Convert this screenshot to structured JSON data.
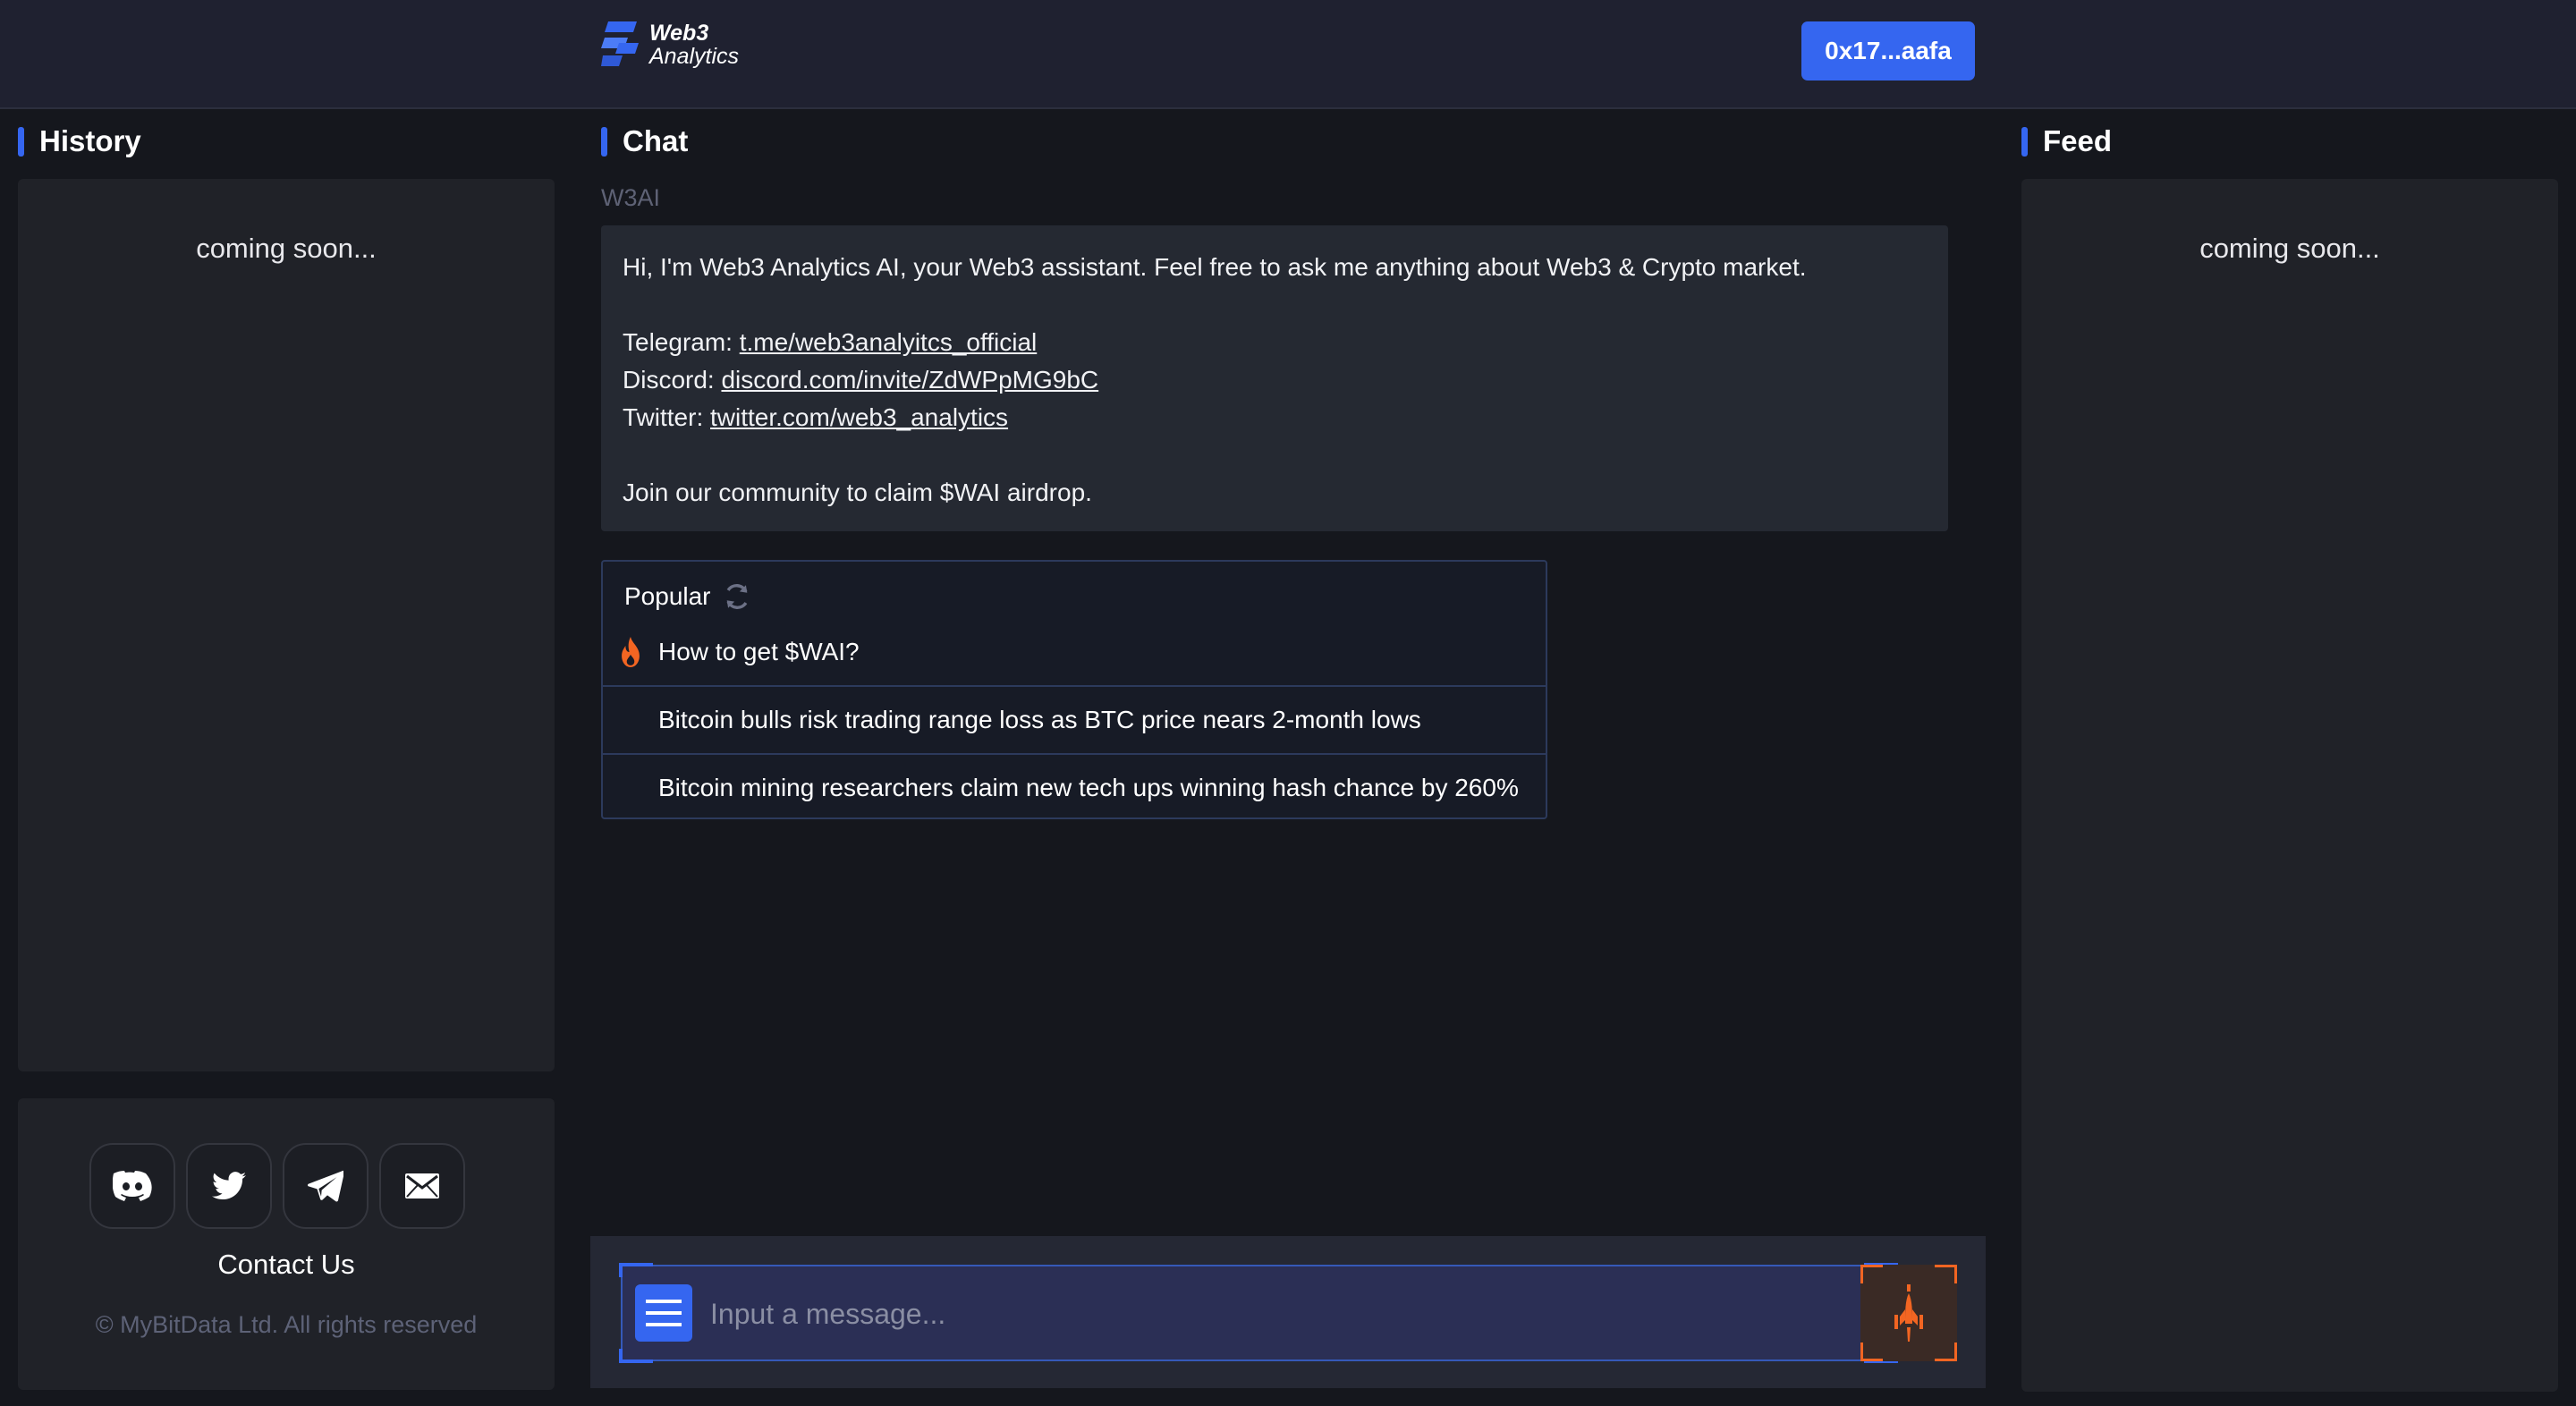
{
  "header": {
    "logo_line1": "Web3",
    "logo_line2": "Analytics",
    "wallet_label": "0x17...aafa",
    "accent_color": "#3566f0"
  },
  "history": {
    "title": "History",
    "placeholder": "coming soon..."
  },
  "contact": {
    "social_icons": [
      "discord-icon",
      "twitter-icon",
      "telegram-icon",
      "mail-icon"
    ],
    "label": "Contact Us",
    "copyright": "© MyBitData Ltd. All rights reserved"
  },
  "chat": {
    "title": "Chat",
    "sender": "W3AI",
    "message": {
      "intro": "Hi, I'm Web3 Analytics AI, your Web3 assistant. Feel free to ask me anything about Web3 & Crypto market.",
      "telegram_label": "Telegram: ",
      "telegram_link": "t.me/web3analyitcs_official",
      "discord_label": "Discord: ",
      "discord_link": "discord.com/invite/ZdWPpMG9bC",
      "twitter_label": "Twitter: ",
      "twitter_link": "twitter.com/web3_analytics",
      "outro": "Join our community to claim $WAI airdrop."
    },
    "popular": {
      "title": "Popular",
      "items": [
        {
          "text": "How to get $WAI?",
          "hot": true
        },
        {
          "text": "Bitcoin bulls risk trading range loss as BTC price nears 2-month lows",
          "hot": false
        },
        {
          "text": "Bitcoin mining researchers claim new tech ups winning hash chance by 260%",
          "hot": false
        }
      ]
    },
    "input": {
      "placeholder": "Input a message...",
      "value": ""
    }
  },
  "feed": {
    "title": "Feed",
    "placeholder": "coming soon..."
  }
}
